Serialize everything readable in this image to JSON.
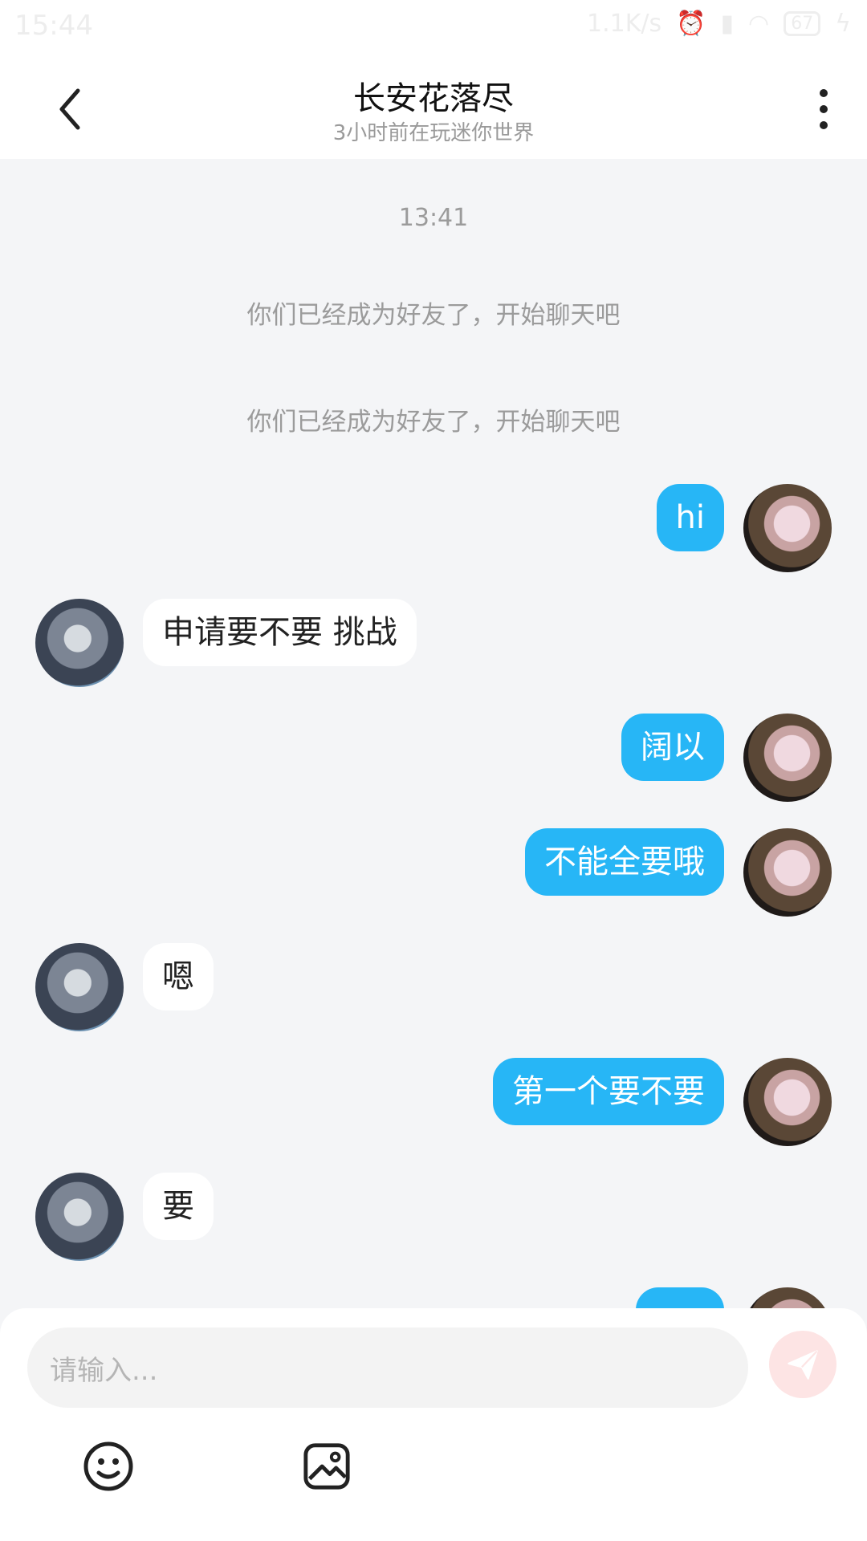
{
  "status_bar": {
    "time": "15:44",
    "network_speed": "1.1K/s",
    "battery": "67"
  },
  "header": {
    "title": "长安花落尽",
    "subtitle": "3小时前在玩迷你世界",
    "back_icon": "chevron-left-icon",
    "more_icon": "more-vertical-icon"
  },
  "chat": {
    "time": "13:41",
    "system_messages": [
      "你们已经成为好友了，开始聊天吧",
      "你们已经成为好友了，开始聊天吧"
    ],
    "messages": [
      {
        "from": "me",
        "text": "hi"
      },
      {
        "from": "other",
        "text": "申请要不要 挑战"
      },
      {
        "from": "me",
        "text": "阔以"
      },
      {
        "from": "me",
        "text": "不能全要哦"
      },
      {
        "from": "other",
        "text": "嗯"
      },
      {
        "from": "me",
        "text": "第一个要不要"
      },
      {
        "from": "other",
        "text": "要"
      }
    ]
  },
  "composer": {
    "placeholder": "请输入...",
    "send_icon": "send-icon",
    "emoji_icon": "emoji-icon",
    "image_icon": "image-icon"
  },
  "colors": {
    "sent_bubble": "#27b6f6",
    "received_bubble": "#ffffff",
    "background": "#f4f5f7"
  }
}
